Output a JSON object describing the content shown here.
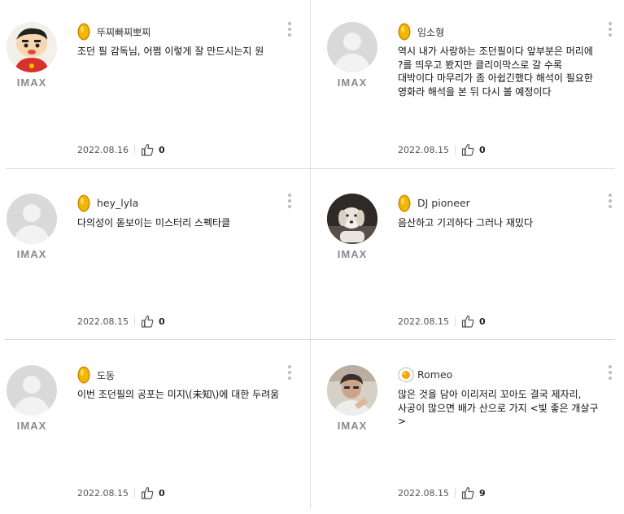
{
  "reviews": [
    {
      "nickname": "뚜찌빠찌뽀찌",
      "text": "조던 필 감독님, 어쩜 이렇게 잘 만드시는지 원",
      "date": "2022.08.16",
      "likes": "0",
      "format": "IMAX",
      "badge": "gold",
      "avatar": "character-avatar"
    },
    {
      "nickname": "임소형",
      "text": "역시 내가 사랑하는 조던필이다 앞부분은 머리에 ?를 띄우고 봤지만 클리이막스로 갈 수록 대박이다 마무리가 좀 아쉽긴했다 해석이 필요한 영화라 해석을 본 뒤 다시 볼 예정이다",
      "date": "2022.08.15",
      "likes": "0",
      "format": "IMAX",
      "badge": "gold",
      "avatar": "default-avatar"
    },
    {
      "nickname": "hey_lyla",
      "text": "다의성이 돋보이는 미스터리 스펙타클",
      "date": "2022.08.15",
      "likes": "0",
      "format": "IMAX",
      "badge": "gold",
      "avatar": "default-avatar"
    },
    {
      "nickname": "DJ pioneer",
      "text": "음산하고 기괴하다 그러나 재밌다",
      "date": "2022.08.15",
      "likes": "0",
      "format": "IMAX",
      "badge": "gold",
      "avatar": "dog-photo-avatar"
    },
    {
      "nickname": "도동",
      "text": "이번 조던필의 공포는 미지\\(未知\\)에 대한 두려움",
      "date": "2022.08.15",
      "likes": "0",
      "format": "IMAX",
      "badge": "gold",
      "avatar": "default-avatar"
    },
    {
      "nickname": "Romeo",
      "text": "많은 것을 담아 이리저리 꼬아도 결국 제자리, 사공이 많으면 배가 산으로 가지 <빛 좋은 개살구>",
      "date": "2022.08.15",
      "likes": "9",
      "format": "IMAX",
      "badge": "egg",
      "avatar": "person-photo-avatar"
    }
  ],
  "colors": {
    "gold_badge": "#F2B705",
    "gold_badge_dark": "#C98A00",
    "egg_yolk": "#F7A600",
    "imax_text": "#8A8A8A",
    "divider": "#D9D9D9"
  }
}
